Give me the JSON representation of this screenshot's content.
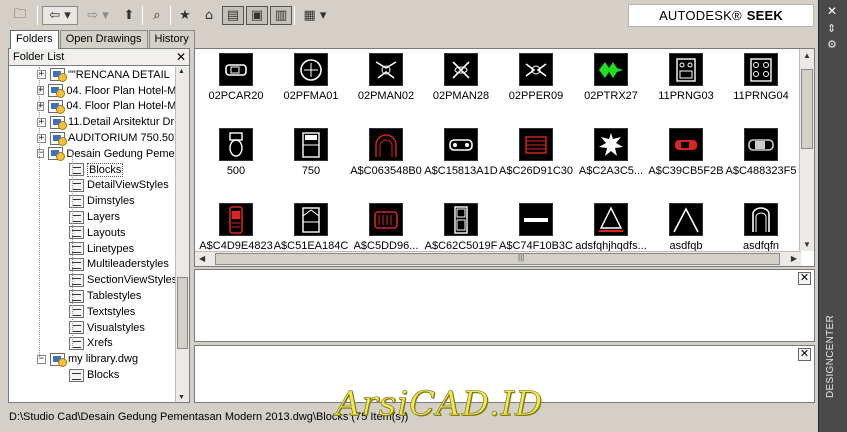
{
  "brand": {
    "company": "AUTODESK®",
    "product": "SEEK"
  },
  "toolbar": {
    "buttons": [
      "open-folder",
      "back",
      "forward",
      "up-folder",
      "search",
      "favorites",
      "home",
      "tree-toggle",
      "preview",
      "description",
      "views"
    ]
  },
  "tabs": [
    {
      "label": "Folders",
      "active": true
    },
    {
      "label": "Open Drawings",
      "active": false
    },
    {
      "label": "History",
      "active": false
    }
  ],
  "folder_list": {
    "title": "Folder List",
    "close": "✕",
    "nodes": [
      {
        "label": "\"\"RENCANA DETAIL",
        "type": "dwg-folder",
        "level": 1,
        "expand": "+"
      },
      {
        "label": "04. Floor Plan Hotel-M",
        "type": "dwg-folder",
        "level": 1,
        "expand": "+"
      },
      {
        "label": "04. Floor Plan Hotel-M",
        "type": "dwg-folder",
        "level": 1,
        "expand": "+"
      },
      {
        "label": "11.Detail Arsitektur Dr",
        "type": "dwg-folder",
        "level": 1,
        "expand": "+"
      },
      {
        "label": "AUDITORIUM 750.50",
        "type": "dwg-folder",
        "level": 1,
        "expand": "+"
      },
      {
        "label": "Desain Gedung Pemen",
        "type": "dwg-folder",
        "level": 1,
        "expand": "−"
      },
      {
        "label": "Blocks",
        "type": "style",
        "level": 2,
        "selected": true
      },
      {
        "label": "DetailViewStyles",
        "type": "style",
        "level": 2
      },
      {
        "label": "Dimstyles",
        "type": "style",
        "level": 2
      },
      {
        "label": "Layers",
        "type": "style",
        "level": 2
      },
      {
        "label": "Layouts",
        "type": "style",
        "level": 2
      },
      {
        "label": "Linetypes",
        "type": "style",
        "level": 2
      },
      {
        "label": "Multileaderstyles",
        "type": "style",
        "level": 2
      },
      {
        "label": "SectionViewStyles",
        "type": "style",
        "level": 2
      },
      {
        "label": "Tablestyles",
        "type": "style",
        "level": 2
      },
      {
        "label": "Textstyles",
        "type": "style",
        "level": 2
      },
      {
        "label": "Visualstyles",
        "type": "style",
        "level": 2
      },
      {
        "label": "Xrefs",
        "type": "style",
        "level": 2
      },
      {
        "label": "my library.dwg",
        "type": "dwg",
        "level": 1,
        "expand": "−"
      },
      {
        "label": "Blocks",
        "type": "style",
        "level": 2
      }
    ]
  },
  "blocks": [
    {
      "name": "02PCAR20",
      "color": "#ffffff",
      "glyph": "car"
    },
    {
      "name": "02PFMA01",
      "color": "#ffffff",
      "glyph": "round"
    },
    {
      "name": "02PMAN02",
      "color": "#ffffff",
      "glyph": "man"
    },
    {
      "name": "02PMAN28",
      "color": "#ffffff",
      "glyph": "man2"
    },
    {
      "name": "02PPER09",
      "color": "#ffffff",
      "glyph": "man3"
    },
    {
      "name": "02PTRX27",
      "color": "#22dd22",
      "glyph": "tree"
    },
    {
      "name": "11PRNG03",
      "color": "#ffffff",
      "glyph": "stove"
    },
    {
      "name": "11PRNG04",
      "color": "#ffffff",
      "glyph": "stove2"
    },
    {
      "name": "500",
      "color": "#ffffff",
      "glyph": "toilet"
    },
    {
      "name": "750",
      "color": "#ffffff",
      "glyph": "bed"
    },
    {
      "name": "A$C063548B0",
      "color": "#dd2222",
      "glyph": "arch"
    },
    {
      "name": "A$C15813A1D",
      "color": "#ffffff",
      "glyph": "car2"
    },
    {
      "name": "A$C26D91C30",
      "color": "#dd2222",
      "glyph": "box"
    },
    {
      "name": "A$C2A3C5...",
      "color": "#ffffff",
      "glyph": "plant"
    },
    {
      "name": "A$C39CB5F2B",
      "color": "#dd2222",
      "glyph": "redcar"
    },
    {
      "name": "A$C488323F5",
      "color": "#cccccc",
      "glyph": "car3"
    },
    {
      "name": "A$C4D9E4823",
      "color": "#dd2222",
      "glyph": "phone"
    },
    {
      "name": "A$C51EA184C",
      "color": "#ffffff",
      "glyph": "bed2"
    },
    {
      "name": "A$C5DD96...",
      "color": "#dd2222",
      "glyph": "grill"
    },
    {
      "name": "A$C62C5019F",
      "color": "#ffffff",
      "glyph": "door"
    },
    {
      "name": "A$C74F10B3C",
      "color": "#ffffff",
      "glyph": "bar"
    },
    {
      "name": "adsfqhjhqdfs...",
      "color": "#ffffff",
      "glyph": "table"
    },
    {
      "name": "asdfqb",
      "color": "#ffffff",
      "glyph": "tent"
    },
    {
      "name": "asdfqfn",
      "color": "#ffffff",
      "glyph": "seat"
    }
  ],
  "preview_close": "✕",
  "description_close": "✕",
  "status_bar": "D:\\Studio Cad\\Desain Gedung Pementasan Modern 2013.dwg\\Blocks (75 Item(s))",
  "watermark": "ArsiCAD.ID",
  "design_center_label": "DESIGNCENTER",
  "palette": {
    "close": "✕",
    "autohide": "⇕",
    "properties": "⚙"
  }
}
